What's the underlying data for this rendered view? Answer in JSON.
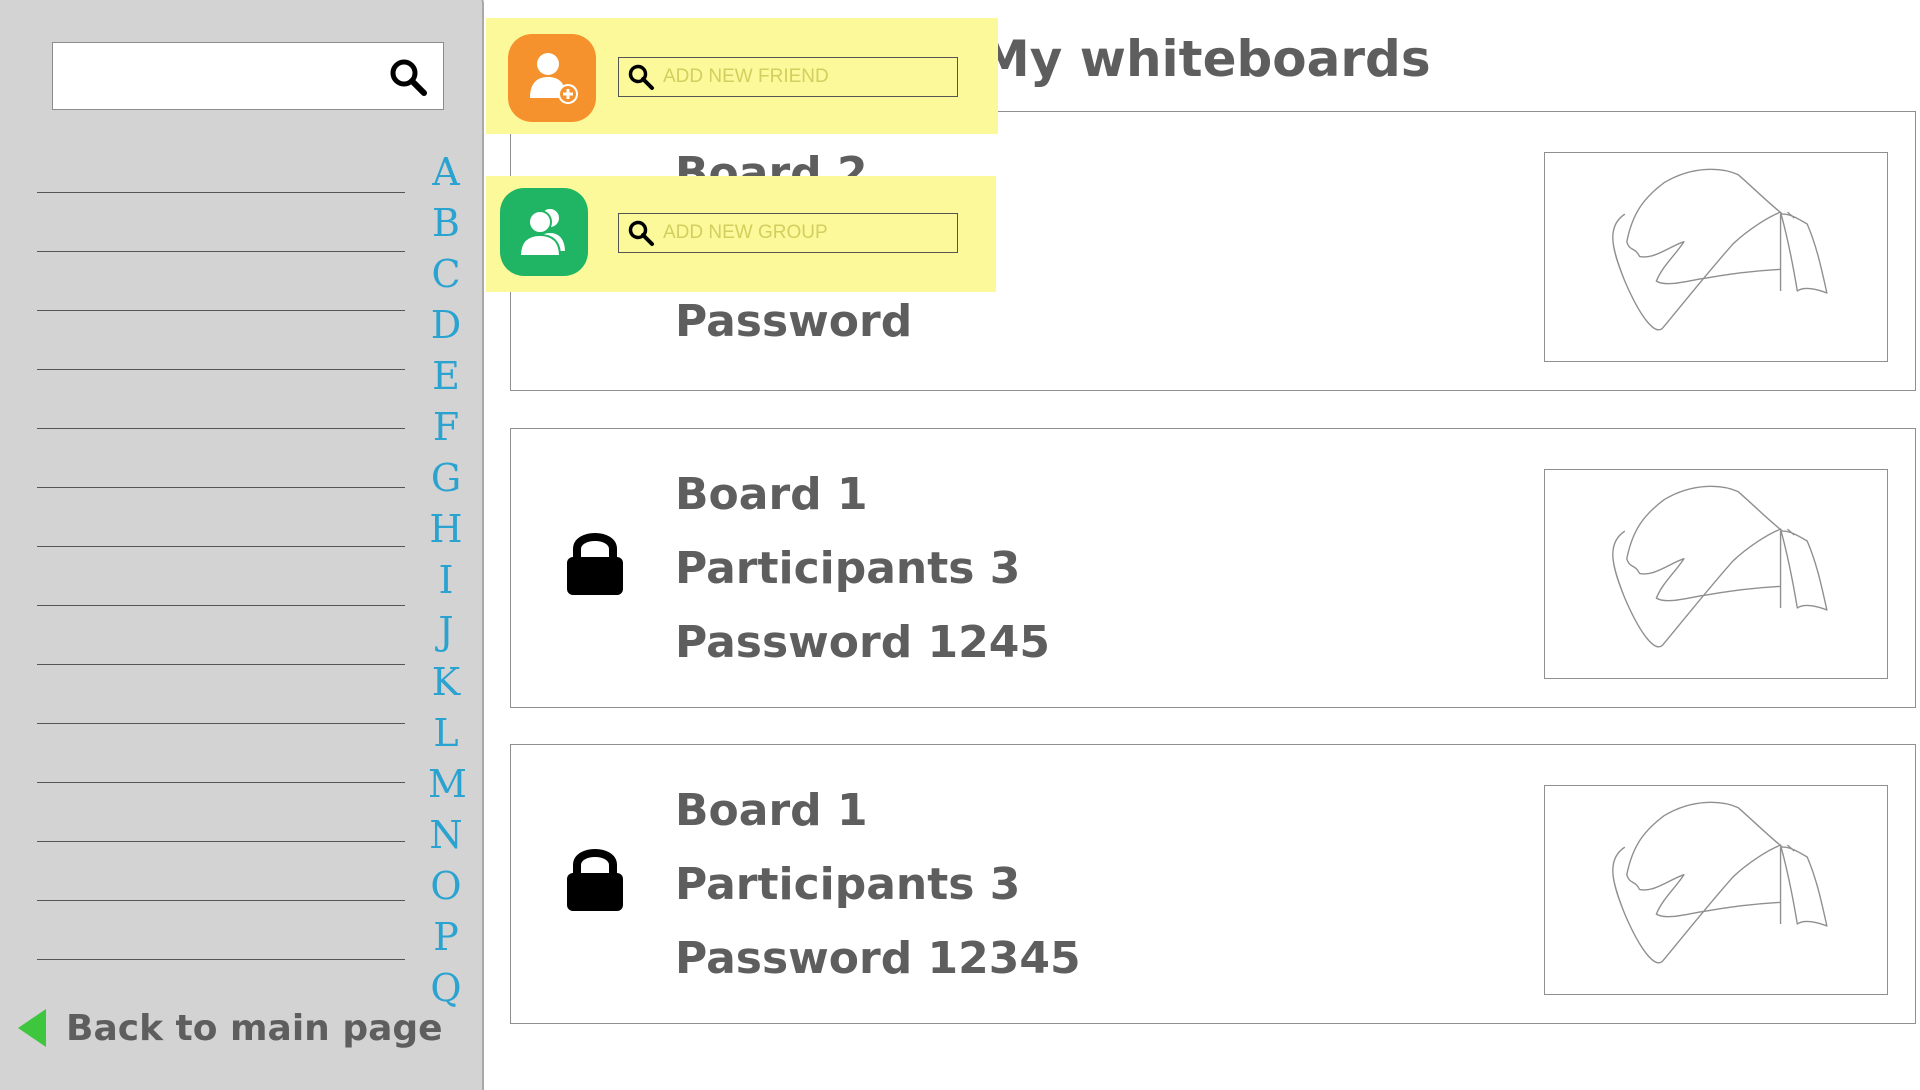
{
  "sidebar": {
    "search": {
      "placeholder": ""
    },
    "alphabet": [
      "A",
      "B",
      "C",
      "D",
      "E",
      "F",
      "G",
      "H",
      "I",
      "J",
      "K",
      "L",
      "M",
      "N",
      "O",
      "P",
      "Q"
    ],
    "back_label": "Back to main page"
  },
  "main": {
    "title": "My whiteboards",
    "boards": [
      {
        "name": "Board 2",
        "participants": "",
        "password": "Password"
      },
      {
        "name": "Board 1",
        "participants": "Participants 3",
        "password": "Password 1245"
      },
      {
        "name": "Board 1",
        "participants": "Participants 3",
        "password": "Password 12345"
      }
    ]
  },
  "popups": {
    "friend": {
      "placeholder": "ADD NEW FRIEND"
    },
    "group": {
      "placeholder": "ADD NEW GROUP"
    }
  },
  "colors": {
    "accent_letters": "#2aa3d0",
    "friend_avatar": "#f5922e",
    "group_avatar": "#1fb565",
    "popup_bg": "#fbf99a",
    "back_arrow": "#3ec63e"
  },
  "icons": {
    "search": "search-icon",
    "lock": "lock-icon",
    "add_friend": "add-friend-icon",
    "add_group": "group-icon",
    "back": "back-arrow-icon"
  }
}
